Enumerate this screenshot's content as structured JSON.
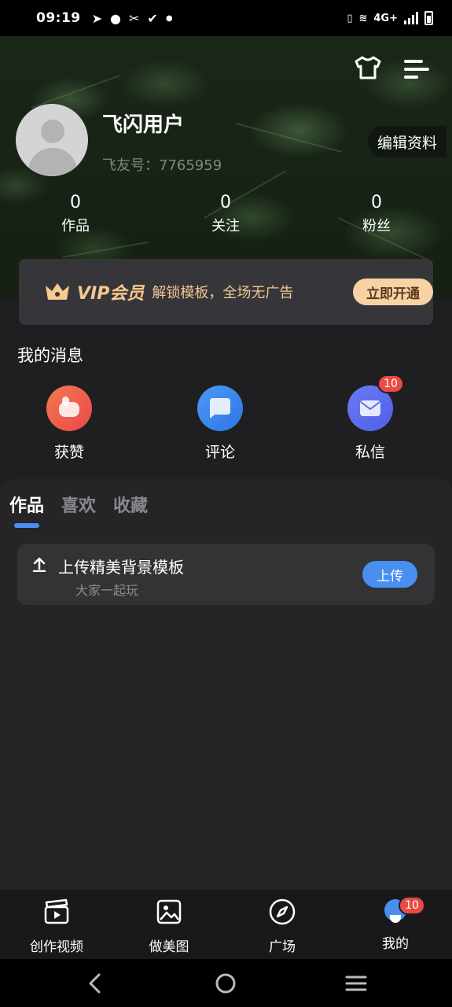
{
  "status_bar": {
    "time": "09:19",
    "left_icons": [
      "telegram-icon",
      "chat-icon",
      "scissors-icon",
      "check-icon",
      "dot-icon"
    ],
    "network": "4G+"
  },
  "header": {
    "username": "飞闪用户",
    "user_id": "飞友号：7765959",
    "edit_profile": "编辑资料",
    "stats": [
      {
        "value": "0",
        "label": "作品"
      },
      {
        "value": "0",
        "label": "关注"
      },
      {
        "value": "0",
        "label": "粉丝"
      }
    ]
  },
  "vip": {
    "title": "VIP会员",
    "description": "解锁模板，全场无广告",
    "button": "立即开通",
    "accent_color": "#f7c98d"
  },
  "messages": {
    "title": "我的消息",
    "items": [
      {
        "label": "获赞",
        "icon": "thumbs-up-icon",
        "color": "#ef6a4f"
      },
      {
        "label": "评论",
        "icon": "comment-icon",
        "color": "#3f8bf0"
      },
      {
        "label": "私信",
        "icon": "mail-icon",
        "color": "#5a6ff0",
        "badge": "10"
      }
    ]
  },
  "works": {
    "tabs": [
      "作品",
      "喜欢",
      "收藏"
    ],
    "active_tab": "作品",
    "upload_card": {
      "title": "上传精美背景模板",
      "subtitle": "大家一起玩",
      "button": "上传"
    }
  },
  "bottom_nav": {
    "items": [
      {
        "label": "创作视频",
        "icon": "video-clapper-icon"
      },
      {
        "label": "做美图",
        "icon": "image-icon"
      },
      {
        "label": "广场",
        "icon": "compass-icon"
      },
      {
        "label": "我的",
        "icon": "profile-icon",
        "badge": "10"
      }
    ]
  }
}
